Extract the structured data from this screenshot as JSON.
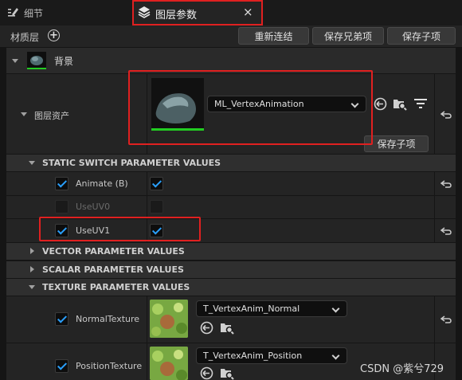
{
  "tabs": {
    "details_label": "细节",
    "layer_params_label": "图层参数",
    "close_glyph": "×"
  },
  "toolbar": {
    "material_layer_label": "材质层",
    "add_glyph": "+",
    "relink_label": "重新连结",
    "save_sibling_label": "保存兄弟项",
    "save_child_label": "保存子项"
  },
  "background_layer": {
    "label": "背景"
  },
  "layer_asset": {
    "label": "图层资产",
    "asset_name": "ML_VertexAnimation",
    "save_child_label": "保存子项"
  },
  "static_switch": {
    "header": "STATIC SWITCH PARAMETER VALUES",
    "params": [
      {
        "label": "Animate (B)",
        "override": true,
        "value": true,
        "enabled": true
      },
      {
        "label": "UseUV0",
        "override": false,
        "value": false,
        "enabled": false
      },
      {
        "label": "UseUV1",
        "override": true,
        "value": true,
        "enabled": true
      }
    ]
  },
  "vector_params": {
    "header": "VECTOR PARAMETER VALUES"
  },
  "scalar_params": {
    "header": "SCALAR PARAMETER VALUES"
  },
  "texture_params": {
    "header": "TEXTURE PARAMETER VALUES",
    "params": [
      {
        "label": "NormalTexture",
        "override": true,
        "texture": "T_VertexAnim_Normal"
      },
      {
        "label": "PositionTexture",
        "override": true,
        "texture": "T_VertexAnim_Position"
      }
    ]
  },
  "watermark": "CSDN @紫兮729",
  "colors": {
    "accent_blue": "#2aa0ff",
    "highlight_red": "#e02020",
    "panel": "#242424"
  }
}
